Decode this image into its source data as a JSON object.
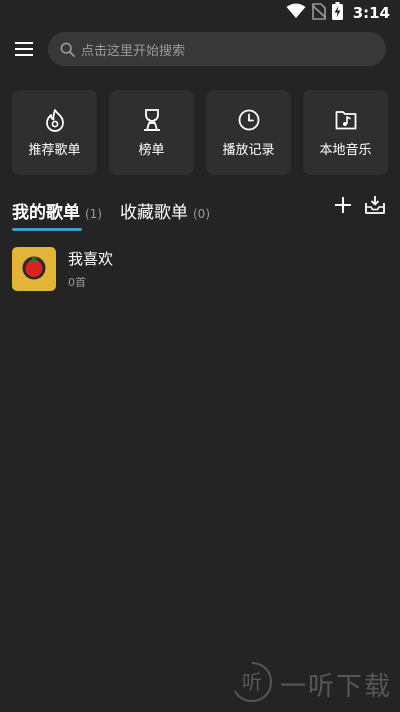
{
  "status_bar": {
    "time": "3:14",
    "icons": [
      "wifi-icon",
      "no-sim-icon",
      "battery-charging-icon"
    ]
  },
  "header": {
    "menu_icon": "hamburger-menu-icon",
    "search": {
      "icon": "search-icon",
      "placeholder": "点击这里开始搜索"
    }
  },
  "quick_tiles": [
    {
      "label": "推荐歌单",
      "icon": "recommend-flame-icon"
    },
    {
      "label": "榜单",
      "icon": "trophy-icon"
    },
    {
      "label": "播放记录",
      "icon": "clock-icon"
    },
    {
      "label": "本地音乐",
      "icon": "music-folder-icon"
    }
  ],
  "tabs": {
    "mine": {
      "label": "我的歌单",
      "count": "(1)",
      "active": true
    },
    "favorites": {
      "label": "收藏歌单",
      "count": "(0)",
      "active": false
    },
    "indicator_color": "#3a9fc0"
  },
  "actions": {
    "add_icon": "plus-icon",
    "import_icon": "inbox-import-icon"
  },
  "playlists": [
    {
      "title": "我喜欢",
      "count": "0首",
      "cover_color": "#e2b437",
      "cover_icon": "tomato-icon"
    }
  ],
  "watermark": {
    "text": "一听下载",
    "logo_char": "听"
  }
}
